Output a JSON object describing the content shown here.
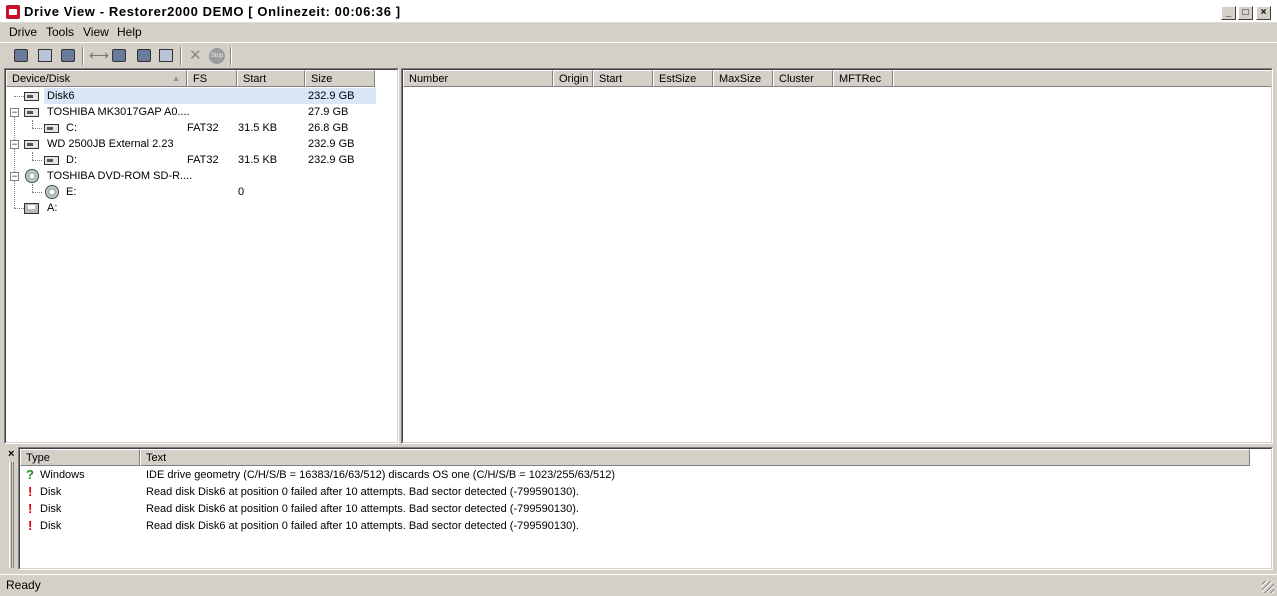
{
  "window": {
    "title": "Drive View - Restorer2000 DEMO [ Onlinezeit: 00:06:36 ]",
    "min": "_",
    "max": "□",
    "close": "×"
  },
  "menu": [
    "Drive",
    "Tools",
    "View",
    "Help"
  ],
  "toolbar": {
    "buttons": [
      "scan-icon",
      "properties-icon",
      "find-icon",
      "connect-icon",
      "open-image-icon",
      "create-image-icon",
      "save-icon",
      "delete-icon",
      "stop-icon"
    ],
    "stop_label": "Stop"
  },
  "device_list": {
    "columns": [
      "Device/Disk",
      "FS",
      "Start",
      "Size"
    ],
    "sort_indicator": "▲",
    "rows": [
      {
        "name": "Disk6",
        "fs": "",
        "start": "",
        "size": "232.9 GB"
      },
      {
        "name": "TOSHIBA MK3017GAP A0....",
        "fs": "",
        "start": "",
        "size": "27.9 GB",
        "expander": "−"
      },
      {
        "name": "C:",
        "fs": "FAT32",
        "start": "31.5 KB",
        "size": "26.8 GB"
      },
      {
        "name": "WD 2500JB External 2.23",
        "fs": "",
        "start": "",
        "size": "232.9 GB",
        "expander": "−"
      },
      {
        "name": "D:",
        "fs": "FAT32",
        "start": "31.5 KB",
        "size": "232.9 GB"
      },
      {
        "name": "TOSHIBA DVD-ROM SD-R....",
        "fs": "",
        "start": "",
        "size": "",
        "expander": "−"
      },
      {
        "name": "E:",
        "fs": "",
        "start": "0",
        "size": ""
      },
      {
        "name": "A:",
        "fs": "",
        "start": "",
        "size": ""
      }
    ]
  },
  "partition_list": {
    "columns": [
      "Number",
      "Origin",
      "Start",
      "EstSize",
      "MaxSize",
      "Cluster",
      "MFTRec"
    ]
  },
  "log": {
    "close": "×",
    "columns": [
      "Type",
      "Text"
    ],
    "rows": [
      {
        "icon": "?",
        "type": "Windows",
        "text": "IDE drive geometry (C/H/S/B = 16383/16/63/512) discards OS one (C/H/S/B = 1023/255/63/512)"
      },
      {
        "icon": "!",
        "type": "Disk",
        "text": "Read disk Disk6 at position 0 failed after 10 attempts. Bad sector detected (-799590130)."
      },
      {
        "icon": "!",
        "type": "Disk",
        "text": "Read disk Disk6 at position 0 failed after 10 attempts. Bad sector detected (-799590130)."
      },
      {
        "icon": "!",
        "type": "Disk",
        "text": "Read disk Disk6 at position 0 failed after 10 attempts. Bad sector detected (-799590130)."
      }
    ]
  },
  "status": {
    "text": "Ready"
  },
  "colors": {
    "selection": "#d9e6f8",
    "error": "#d40000",
    "info": "#1e8a2a"
  }
}
